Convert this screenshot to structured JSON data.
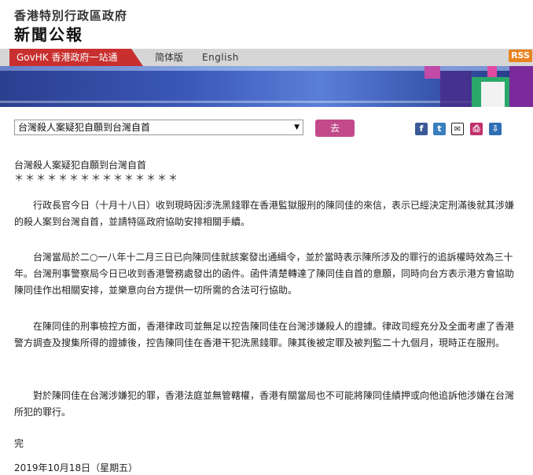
{
  "header": {
    "department": "香港特別行政區政府",
    "title": "新聞公報"
  },
  "nav": {
    "govhk": "GovHK 香港政府一站通",
    "simplified": "简体版",
    "english": "English",
    "rss": "RSS"
  },
  "toolbar": {
    "select_value": "台灣殺人案疑犯自願到台灣自首",
    "go_label": "去",
    "share_icons": [
      "facebook-icon",
      "twitter-icon",
      "mail-icon",
      "print-icon",
      "save-icon"
    ]
  },
  "article": {
    "headline": "台灣殺人案疑犯自願到台灣自首",
    "stars": "＊＊＊＊＊＊＊＊＊＊＊＊＊＊＊",
    "paragraphs": [
      "　　行政長官今日（十月十八日）收到現時因涉洗黑錢罪在香港監獄服刑的陳同佳的來信，表示已經決定刑滿後就其涉嫌的殺人案到台灣自首，並請特區政府協助安排相關手續。",
      "　　台灣當局於二○一八年十二月三日已向陳同佳就該案發出通緝令，並於當時表示陳所涉及的罪行的追訴權時效為三十年。台灣刑事警察局今日已收到香港警務處發出的函件。函件清楚轉達了陳同佳自首的意願，同時向台方表示港方會協助陳同佳作出相關安排，並樂意向台方提供一切所需的合法可行協助。",
      "　　在陳同佳的刑事檢控方面，香港律政司並無足以控告陳同佳在台灣涉嫌殺人的證據。律政司經充分及全面考慮了香港警方調查及搜集所得的證據後，控告陳同佳在香港干犯洗黑錢罪。陳其後被定罪及被判監二十九個月，現時正在服刑。",
      "　　對於陳同佳在台灣涉嫌犯的罪，香港法庭並無管轄權，香港有關當局也不可能將陳同佳績押或向他追訴他涉嫌在台灣所犯的罪行。"
    ],
    "end": "完",
    "date": "2019年10月18日（星期五）"
  }
}
